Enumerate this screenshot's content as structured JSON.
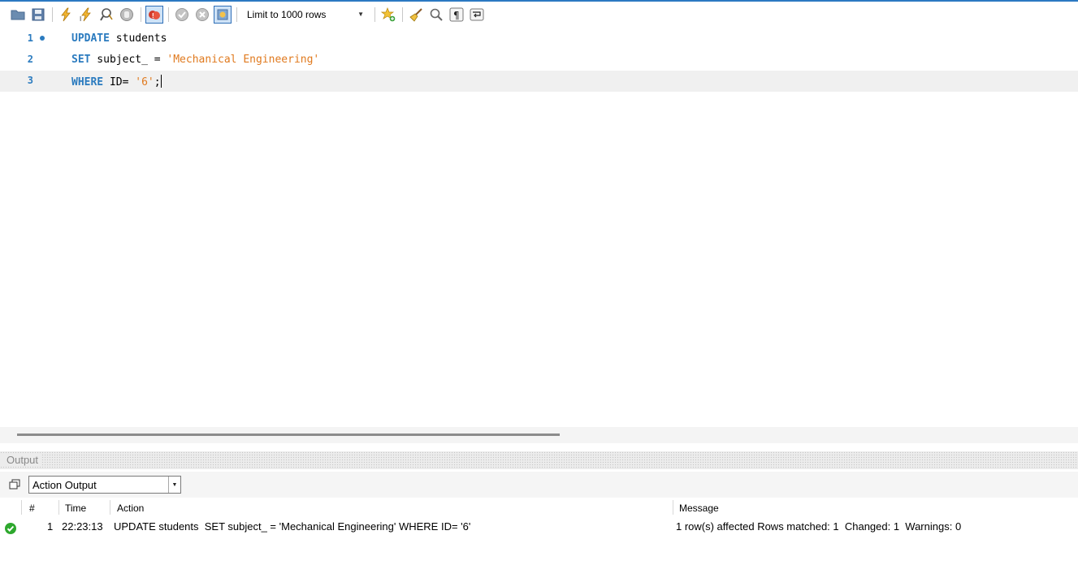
{
  "toolbar": {
    "icons": [
      "open-folder-icon",
      "save-icon",
      "execute-lightning-icon",
      "execute-current-lightning-icon",
      "explain-magnifier-icon",
      "stop-icon",
      "toggle-stop-on-error-icon",
      "commit-icon",
      "rollback-icon",
      "toggle-autocommit-icon",
      "favorite-star-icon",
      "beautify-broom-icon",
      "find-icon",
      "invisible-characters-icon",
      "wrap-lines-icon"
    ],
    "limit_label": "Limit to 1000 rows"
  },
  "editor": {
    "lines": [
      {
        "num": "1",
        "tokens": [
          {
            "t": "UPDATE",
            "c": "kw"
          },
          {
            "t": " students",
            "c": ""
          }
        ]
      },
      {
        "num": "2",
        "tokens": [
          {
            "t": "SET",
            "c": "kw"
          },
          {
            "t": " subject_ = ",
            "c": ""
          },
          {
            "t": "'Mechanical Engineering'",
            "c": "str"
          }
        ]
      },
      {
        "num": "3",
        "tokens": [
          {
            "t": "WHERE",
            "c": "kw"
          },
          {
            "t": " ID= ",
            "c": ""
          },
          {
            "t": "'6'",
            "c": "str"
          },
          {
            "t": ";",
            "c": ""
          }
        ]
      }
    ],
    "line1_num": "1",
    "line2_num": "2",
    "line3_num": "3"
  },
  "output": {
    "panel_label": "Output",
    "selector_value": "Action Output",
    "columns": {
      "num": "#",
      "time": "Time",
      "action": "Action",
      "message": "Message"
    },
    "rows": [
      {
        "num": "1",
        "time": "22:23:13",
        "action": "UPDATE students  SET subject_ = 'Mechanical Engineering' WHERE ID= '6'",
        "message": "1 row(s) affected Rows matched: 1  Changed: 1  Warnings: 0",
        "status": "success"
      }
    ]
  },
  "colors": {
    "keyword": "#2b7bbf",
    "string": "#e07a1f",
    "success": "#2ea82e",
    "accent": "#2b79c2"
  }
}
